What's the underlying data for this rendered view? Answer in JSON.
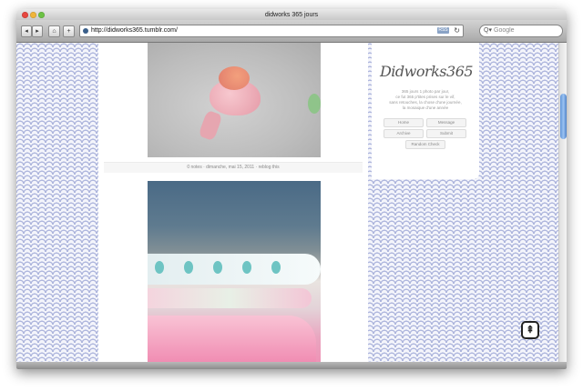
{
  "window": {
    "title": "didworks 365 jours"
  },
  "toolbar": {
    "back_symbol": "◂",
    "forward_symbol": "▸",
    "home_symbol": "⌂",
    "add_symbol": "+",
    "url": "http://didworks365.tumblr.com/",
    "rss_label": "RSS",
    "reload_symbol": "↻",
    "search_placeholder": "Google",
    "search_symbol": "Q▾"
  },
  "posts": [
    {
      "meta": "0 notes · dimanche, mai 15, 2011 · reblog this"
    }
  ],
  "sidebar": {
    "logo": "Didworks365",
    "description_lines": [
      "365 jours 1 photo par jour,",
      "ce fut 365 p'tites prises sur le vif,",
      "sans retouches, la chose d'une journée,",
      "la mosaique d'une année"
    ],
    "nav": [
      "Home",
      "Message",
      "Archive",
      "Submit"
    ],
    "random": "Random Check"
  },
  "back_to_top": {
    "symbol": "⇞"
  },
  "colors": {
    "pattern": "#aeb6dd",
    "scroll_thumb": "#5f94d8"
  }
}
